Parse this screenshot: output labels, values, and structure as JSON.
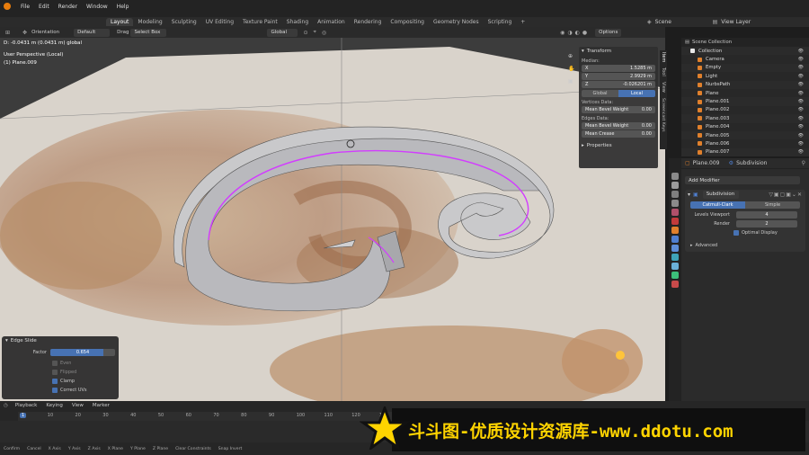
{
  "topbar": {
    "menus": [
      "File",
      "Edit",
      "Render",
      "Window",
      "Help"
    ],
    "workspaces": [
      "Layout",
      "Modeling",
      "Sculpting",
      "UV Editing",
      "Texture Paint",
      "Shading",
      "Animation",
      "Rendering",
      "Compositing",
      "Geometry Nodes",
      "Scripting"
    ],
    "active_workspace": "Layout",
    "scene": "Scene",
    "view_layer": "View Layer",
    "add_tab": "+"
  },
  "header": {
    "orientation_label": "Orientation",
    "orientation_value": "Default",
    "drag_label": "Drag",
    "drag_value": "Select Box",
    "transform_orientation": "Global",
    "options": "Options"
  },
  "viewport": {
    "status_line": "D: -0.0431 m (0.0431 m) global",
    "view_name": "User Perspective (Local)",
    "object_name": "(1) Plane.009"
  },
  "npanel": {
    "section": "Transform",
    "median_label": "Median:",
    "x_label": "X",
    "x_value": "1.5285 m",
    "y_label": "Y",
    "y_value": "2.9929 m",
    "z_label": "Z",
    "z_value": "-0.026201 m",
    "global": "Global",
    "local": "Local",
    "vertices_label": "Vertices Data:",
    "mean_bevel_weight_v": "Mean Bevel Weight",
    "mbw_v_value": "0.00",
    "edges_label": "Edges Data:",
    "mean_bevel_weight_e": "Mean Bevel Weight",
    "mbw_e_value": "0.00",
    "mean_crease": "Mean Crease",
    "mc_value": "0.00",
    "properties": "Properties",
    "tabs": [
      "Item",
      "Tool",
      "View",
      "Screencast Keys"
    ]
  },
  "outliner": {
    "title": "Scene Collection",
    "rows": [
      "Collection",
      "Camera",
      "Empty",
      "Light",
      "NurbsPath",
      "Plane",
      "Plane.001",
      "Plane.002",
      "Plane.003",
      "Plane.004",
      "Plane.005",
      "Plane.006",
      "Plane.007"
    ]
  },
  "properties": {
    "object": "Plane.009",
    "modifier_ref": "Subdivision",
    "add_modifier": "Add Modifier",
    "modifier_name": "Subdivision",
    "catmull": "Catmull-Clark",
    "simple": "Simple",
    "levels_viewport_label": "Levels Viewport",
    "levels_viewport_value": "4",
    "render_label": "Render",
    "render_value": "2",
    "optimal_display": "Optimal Display",
    "advanced": "Advanced"
  },
  "adjust_panel": {
    "title": "Edge Slide",
    "factor_label": "Factor",
    "factor_value": "0.654",
    "factor_fill": 0.82,
    "even": "Even",
    "flipped": "Flipped",
    "clamp": "Clamp",
    "correct_uvs": "Correct UVs"
  },
  "timeline": {
    "playback": "Playback",
    "keying": "Keying",
    "view": "View",
    "marker": "Marker",
    "current_frame": "1",
    "ticks": [
      "1",
      "10",
      "20",
      "30",
      "40",
      "50",
      "60",
      "70",
      "80",
      "90",
      "100",
      "110",
      "120",
      "130"
    ],
    "status_items": [
      "Confirm",
      "Cancel",
      "X Axis",
      "Y Axis",
      "Z Axis",
      "X Plane",
      "Y Plane",
      "Z Plane",
      "Clear Constraints",
      "Snap Invert"
    ]
  },
  "banner": {
    "text": "斗斗图-优质设计资源库-www.ddotu.com"
  },
  "colors": {
    "accent": "#4772b3",
    "selection_edge": "#d23cff",
    "banner_text": "#ffd400"
  }
}
